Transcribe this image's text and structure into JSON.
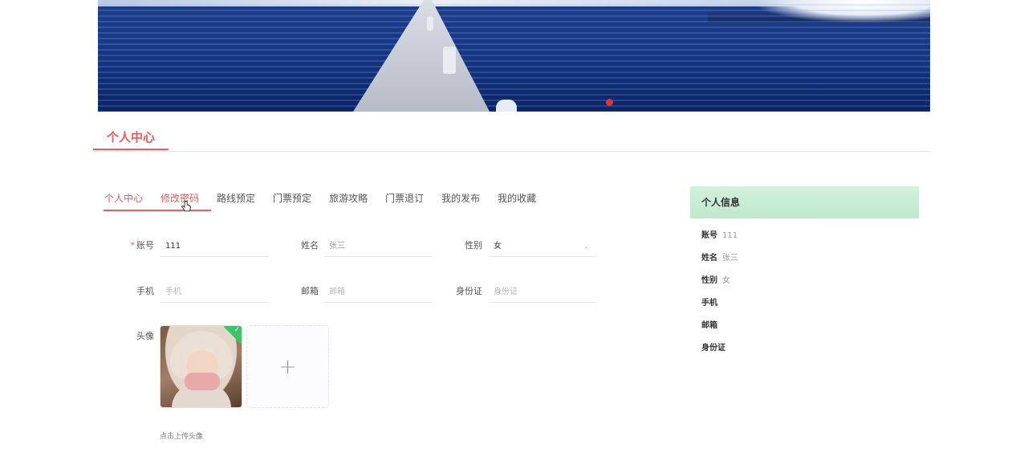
{
  "section": {
    "title": "个人中心"
  },
  "tabs": [
    {
      "label": "个人中心"
    },
    {
      "label": "修改密码"
    },
    {
      "label": "路线预定"
    },
    {
      "label": "门票预定"
    },
    {
      "label": "旅游攻略"
    },
    {
      "label": "门票退订"
    },
    {
      "label": "我的发布"
    },
    {
      "label": "我的收藏"
    }
  ],
  "form": {
    "account": {
      "label": "账号",
      "required_mark": "*",
      "value": "111"
    },
    "name": {
      "label": "姓名",
      "value": "张三"
    },
    "gender": {
      "label": "性别",
      "value": "女"
    },
    "phone": {
      "label": "手机",
      "placeholder": "手机"
    },
    "email": {
      "label": "邮箱",
      "placeholder": "邮箱"
    },
    "id_card": {
      "label": "身份证",
      "placeholder": "身份证"
    },
    "avatar": {
      "label": "头像",
      "upload_hint": "点击上传头像",
      "plus": "+"
    }
  },
  "panel": {
    "title": "个人信息",
    "rows": [
      {
        "key": "账号",
        "value": "111"
      },
      {
        "key": "姓名",
        "value": "张三"
      },
      {
        "key": "性别",
        "value": "女"
      },
      {
        "key": "手机",
        "value": ""
      },
      {
        "key": "邮箱",
        "value": ""
      },
      {
        "key": "身份证",
        "value": ""
      }
    ]
  },
  "colors": {
    "accent": "#ee5a5a",
    "panel_header": "#c6ebd3",
    "success": "#3ec46d"
  }
}
